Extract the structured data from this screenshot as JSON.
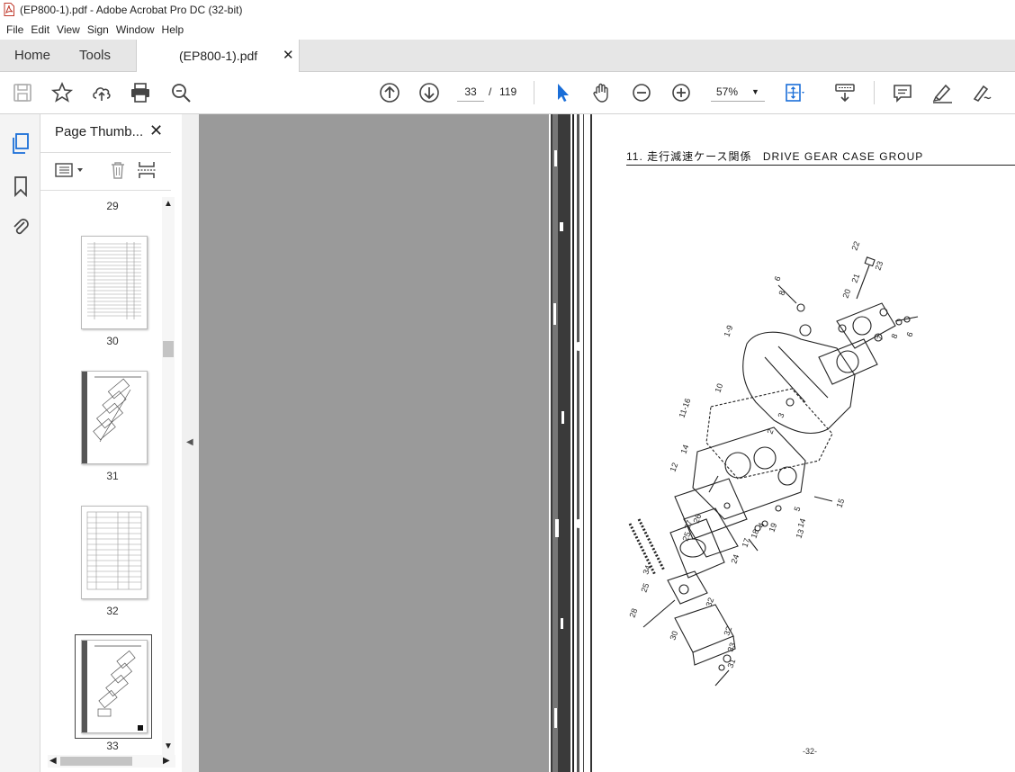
{
  "window": {
    "title": "(EP800-1).pdf - Adobe Acrobat Pro DC (32-bit)"
  },
  "menu": [
    "File",
    "Edit",
    "View",
    "Sign",
    "Window",
    "Help"
  ],
  "tabs": {
    "home": "Home",
    "tools": "Tools",
    "document": "(EP800-1).pdf"
  },
  "toolbar": {
    "page_current": "33",
    "page_separator": "/",
    "page_total": "119",
    "zoom": "57%"
  },
  "panel": {
    "title": "Page Thumb...",
    "thumbnails": [
      {
        "page": "29",
        "kind": "list",
        "selected": false
      },
      {
        "page": "30",
        "kind": "list",
        "selected": false
      },
      {
        "page": "31",
        "kind": "diagram",
        "selected": false
      },
      {
        "page": "32",
        "kind": "list",
        "selected": false
      },
      {
        "page": "33",
        "kind": "diagram",
        "selected": true
      }
    ]
  },
  "document_page": {
    "heading_number": "11.",
    "heading_jp": "走行減速ケース関係",
    "heading_en": "DRIVE GEAR CASE GROUP",
    "footer": "-32-",
    "callouts": [
      "22",
      "23",
      "21",
      "20",
      "6",
      "8",
      "7",
      "8",
      "6",
      "1-9",
      "10",
      "3",
      "2",
      "11-16",
      "14",
      "12",
      "15",
      "5",
      "14",
      "13",
      "19",
      "4",
      "18",
      "17",
      "26",
      "27",
      "25",
      "24",
      "34",
      "32",
      "25",
      "28",
      "30",
      "32",
      "33",
      "31"
    ]
  },
  "colors": {
    "accent": "#1a6ed8",
    "doc_background": "#9a9a9a",
    "tab_bar": "#e6e6e6"
  }
}
